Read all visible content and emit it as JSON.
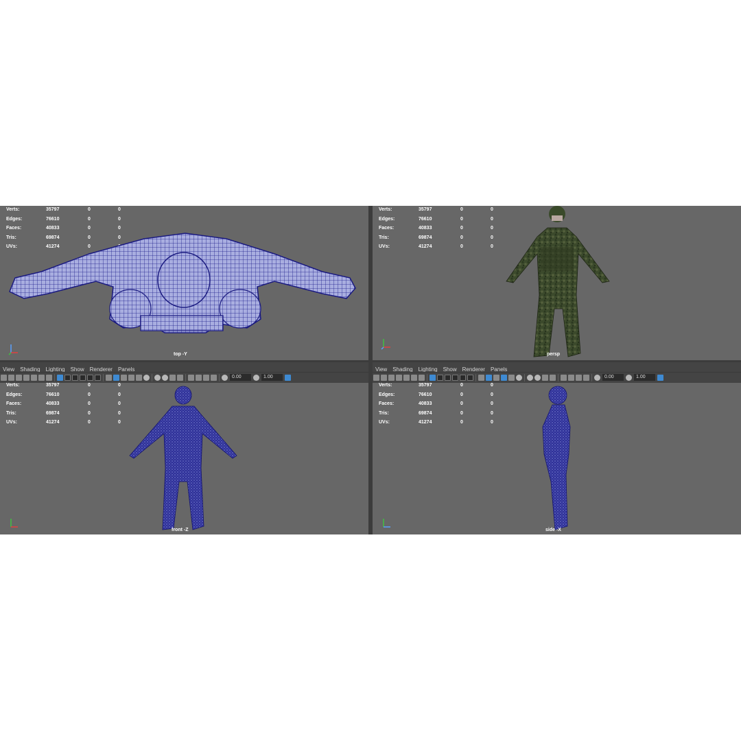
{
  "stats": {
    "labels": [
      "Verts:",
      "Edges:",
      "Faces:",
      "Tris:",
      "UVs:"
    ],
    "values": [
      "35797",
      "76610",
      "40833",
      "69874",
      "41274"
    ],
    "selected": [
      "0",
      "0",
      "0",
      "0",
      "0"
    ],
    "components": [
      "0",
      "0",
      "0",
      "0",
      "0"
    ]
  },
  "menu": [
    "View",
    "Shading",
    "Lighting",
    "Show",
    "Renderer",
    "Panels"
  ],
  "toolbar": {
    "exposure": "0.00",
    "gamma": "1.00"
  },
  "viewports": {
    "top": {
      "camera": "top -Y"
    },
    "persp": {
      "camera": "persp"
    },
    "front": {
      "camera": "front -Z"
    },
    "side": {
      "camera": "side -X"
    }
  },
  "colors": {
    "wire": "#1f1f8c",
    "viewport_bg": "#676767",
    "camo": "#3c4a2c",
    "panel_bg": "#444444"
  },
  "icons": [
    "camera-icon",
    "grid-icon",
    "wireframe-icon",
    "shaded-icon",
    "light-icon",
    "isolate-icon",
    "xray-icon",
    "exposure-icon",
    "color-space-icon"
  ]
}
